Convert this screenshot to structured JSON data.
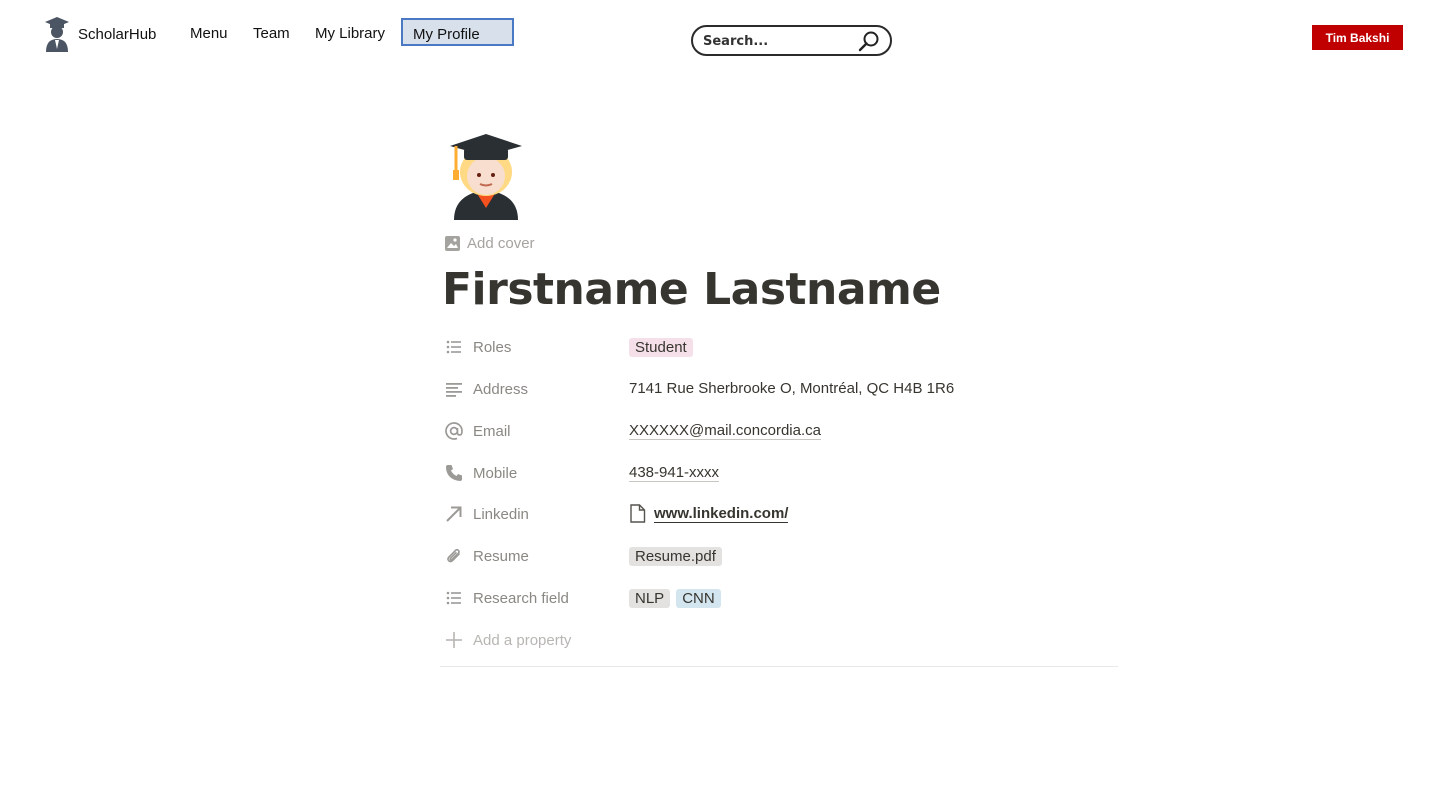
{
  "nav": {
    "brand": "ScholarHub",
    "links": [
      "Menu",
      "Team",
      "My Library"
    ],
    "active_link": "My Profile",
    "search_placeholder": "Search...",
    "user_button": "Tim Bakshi",
    "user_button_color": "#c00000"
  },
  "page": {
    "avatar_icon": "graduate-student-emoji",
    "add_cover": "Add cover",
    "title": "Firstname Lastname"
  },
  "properties": {
    "roles": {
      "label": "Roles",
      "icon": "list-icon",
      "tag": "Student",
      "tag_color": "#f5e0e9"
    },
    "address": {
      "label": "Address",
      "icon": "text-icon",
      "value": "7141 Rue Sherbrooke O, Montréal, QC H4B 1R6"
    },
    "email": {
      "label": "Email",
      "icon": "at-icon",
      "value": "XXXXXX@mail.concordia.ca"
    },
    "mobile": {
      "label": "Mobile",
      "icon": "phone-icon",
      "value": "438-941-xxxx"
    },
    "linkedin": {
      "label": "Linkedin",
      "icon": "arrow-up-right-icon",
      "value": "www.linkedin.com/"
    },
    "resume": {
      "label": "Resume",
      "icon": "paperclip-icon",
      "value": "Resume.pdf",
      "tag_color": "#e3e2e0"
    },
    "research": {
      "label": "Research field",
      "icon": "list-icon",
      "tags": [
        "NLP",
        "CNN"
      ],
      "tag_colors": [
        "#e3e2e0",
        "#d3e5ef"
      ]
    },
    "add_property": "Add a property"
  }
}
